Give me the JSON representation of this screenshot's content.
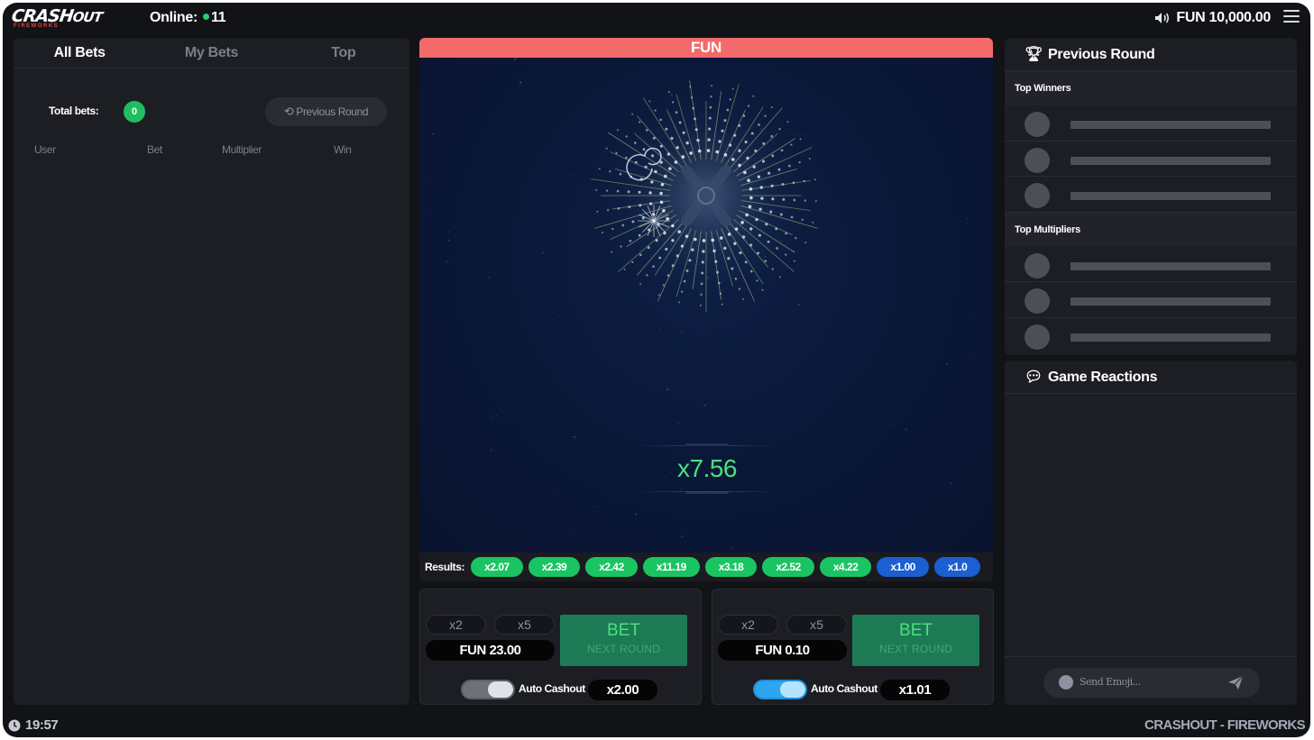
{
  "app": {
    "logo_main": "CRASH",
    "logo_out": "OUT",
    "logo_sub": "FIREWORKS",
    "online_label": "Online:",
    "online_count": "11",
    "balance": "FUN 10,000.00",
    "icons": {
      "sound": "speaker-icon",
      "menu": "hamburger-menu-icon"
    }
  },
  "left": {
    "tabs": [
      {
        "label": "All Bets",
        "active": true
      },
      {
        "label": "My Bets",
        "active": false
      },
      {
        "label": "Top",
        "active": false
      }
    ],
    "total_bets_label": "Total bets:",
    "total_bets_count": "0",
    "previous_round_label": "Previous Round",
    "columns": [
      "User",
      "Bet",
      "Multiplier",
      "Win"
    ]
  },
  "game": {
    "header": "FUN",
    "multiplier": "x7.56",
    "results_label": "Results:",
    "results": [
      {
        "value": "x2.07",
        "color": "green"
      },
      {
        "value": "x2.39",
        "color": "green"
      },
      {
        "value": "x2.42",
        "color": "green"
      },
      {
        "value": "x11.19",
        "color": "green"
      },
      {
        "value": "x3.18",
        "color": "green"
      },
      {
        "value": "x2.52",
        "color": "green"
      },
      {
        "value": "x4.22",
        "color": "green"
      },
      {
        "value": "x1.00",
        "color": "blue"
      },
      {
        "value": "x1.0",
        "color": "blue"
      }
    ]
  },
  "bets": [
    {
      "quick1": "x2",
      "quick2": "x5",
      "amount": "FUN 23.00",
      "bet_label": "BET",
      "bet_sub": "NEXT ROUND",
      "auto_cashout_label": "Auto Cashout",
      "auto_cashout_value": "x2.00",
      "auto_on": false
    },
    {
      "quick1": "x2",
      "quick2": "x5",
      "amount": "FUN 0.10",
      "bet_label": "BET",
      "bet_sub": "NEXT ROUND",
      "auto_cashout_label": "Auto Cashout",
      "auto_cashout_value": "x1.01",
      "auto_on": true
    }
  ],
  "right": {
    "previous_round_title": "Previous Round",
    "top_winners_label": "Top Winners",
    "top_multipliers_label": "Top Multipliers",
    "reactions_title": "Game Reactions",
    "emoji_placeholder": "Send Emoji..."
  },
  "footer": {
    "time": "19:57",
    "brand": "CRASHOUT - FIREWORKS"
  },
  "colors": {
    "accent_green": "#1bc462",
    "accent_blue": "#1b5fd1",
    "header_red": "#f26a6a",
    "bet_button": "#1c7a55"
  }
}
